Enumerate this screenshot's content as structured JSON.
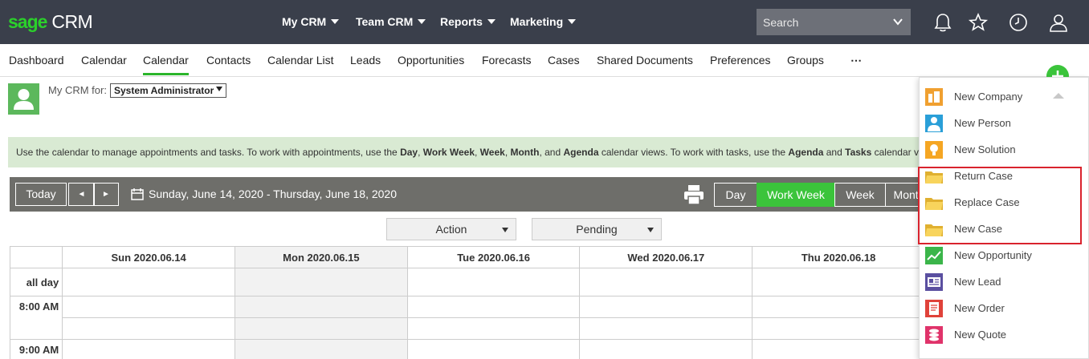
{
  "brand": {
    "sage": "sage",
    "crm": "CRM"
  },
  "topnav": [
    {
      "label": "My CRM"
    },
    {
      "label": "Team CRM"
    },
    {
      "label": "Reports"
    },
    {
      "label": "Marketing"
    }
  ],
  "search": {
    "placeholder": "Search"
  },
  "tabs": [
    {
      "label": "Dashboard"
    },
    {
      "label": "Calendar"
    },
    {
      "label": "Calendar"
    },
    {
      "label": "Contacts"
    },
    {
      "label": "Calendar List"
    },
    {
      "label": "Leads"
    },
    {
      "label": "Opportunities"
    },
    {
      "label": "Forecasts"
    },
    {
      "label": "Cases"
    },
    {
      "label": "Shared Documents"
    },
    {
      "label": "Preferences"
    },
    {
      "label": "Groups"
    },
    {
      "label": "⋯"
    }
  ],
  "mycrm": {
    "label": "My CRM for:",
    "user": "System Administrator"
  },
  "info": {
    "t1": "Use the calendar to manage appointments and tasks. To work with appointments, use the ",
    "day": "Day",
    "comma1": ", ",
    "workweek": "Work Week",
    "comma2": ", ",
    "week": "Week",
    "comma3": ", ",
    "month": "Month",
    "t2": ", and ",
    "agenda": "Agenda",
    "t3": " calendar views. To work with tasks, use the ",
    "agenda2": "Agenda",
    "t4": " and ",
    "tasks": "Tasks",
    "t5": " calendar views."
  },
  "calendar": {
    "today": "Today",
    "prev": "◄",
    "next": "►",
    "range": "Sunday, June 14, 2020 - Thursday, June 18, 2020",
    "views": [
      {
        "label": "Day"
      },
      {
        "label": "Work Week"
      },
      {
        "label": "Week"
      },
      {
        "label": "Month"
      }
    ],
    "filters": {
      "action": "Action",
      "status": "Pending"
    },
    "columns": [
      "Sun 2020.06.14",
      "Mon 2020.06.15",
      "Tue 2020.06.16",
      "Wed 2020.06.17",
      "Thu 2020.06.18"
    ],
    "rows": [
      "all day",
      "8:00 AM",
      "9:00 AM"
    ]
  },
  "newmenu": [
    {
      "label": "New Company",
      "color": "#f0a030"
    },
    {
      "label": "New Person",
      "color": "#2a9fd8"
    },
    {
      "label": "New Solution",
      "color": "#f5a623"
    },
    {
      "label": "Return Case",
      "color": "#f5c542"
    },
    {
      "label": "Replace Case",
      "color": "#f5c542"
    },
    {
      "label": "New Case",
      "color": "#f5c542"
    },
    {
      "label": "New Opportunity",
      "color": "#3bb54a"
    },
    {
      "label": "New Lead",
      "color": "#5a4fa0"
    },
    {
      "label": "New Order",
      "color": "#e0423a"
    },
    {
      "label": "New Quote",
      "color": "#e0336a"
    }
  ],
  "colors": {
    "accent": "#3bc43b",
    "topbar": "#3a3f4b",
    "highlight": "#d9232d"
  }
}
